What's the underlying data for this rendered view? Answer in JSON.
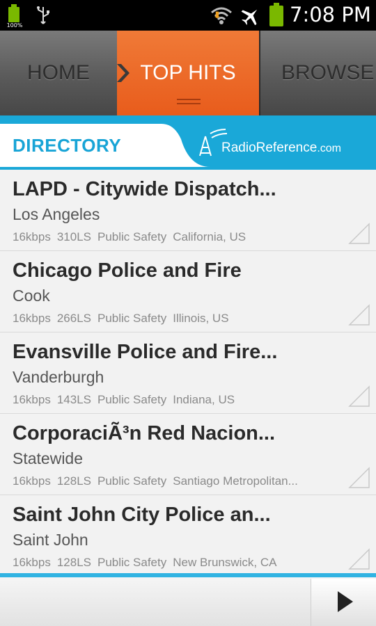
{
  "status_bar": {
    "battery_small_label": "100%",
    "time": "7:08 PM",
    "icons": [
      "battery-icon",
      "usb-icon",
      "wifi-icon",
      "airplane-mode-icon",
      "battery-icon"
    ]
  },
  "tabs": [
    {
      "label": "HOME",
      "active": false
    },
    {
      "label": "TOP HITS",
      "active": true
    },
    {
      "label": "BROWSE",
      "active": false
    }
  ],
  "directory": {
    "label": "DIRECTORY",
    "logo_text": "RadioReference",
    "logo_suffix": ".com"
  },
  "feeds": [
    {
      "title": "LAPD - Citywide Dispatch...",
      "location": "Los Angeles",
      "bitrate": "16kbps",
      "listeners": "310LS",
      "genre": "Public Safety",
      "region": "California, US"
    },
    {
      "title": "Chicago Police and Fire",
      "location": "Cook",
      "bitrate": "16kbps",
      "listeners": "266LS",
      "genre": "Public Safety",
      "region": "Illinois, US"
    },
    {
      "title": "Evansville Police and Fire...",
      "location": "Vanderburgh",
      "bitrate": "16kbps",
      "listeners": "143LS",
      "genre": "Public Safety",
      "region": "Indiana, US"
    },
    {
      "title": "CorporaciÃ³n Red Nacion...",
      "location": "Statewide",
      "bitrate": "16kbps",
      "listeners": "128LS",
      "genre": "Public Safety",
      "region": "Santiago Metropolitan..."
    },
    {
      "title": "Saint John City Police an...",
      "location": "Saint John",
      "bitrate": "16kbps",
      "listeners": "128LS",
      "genre": "Public Safety",
      "region": "New Brunswick, CA"
    }
  ],
  "colors": {
    "accent_orange": "#e85c1c",
    "accent_blue": "#1aa8d8",
    "battery_green": "#7ab800"
  }
}
